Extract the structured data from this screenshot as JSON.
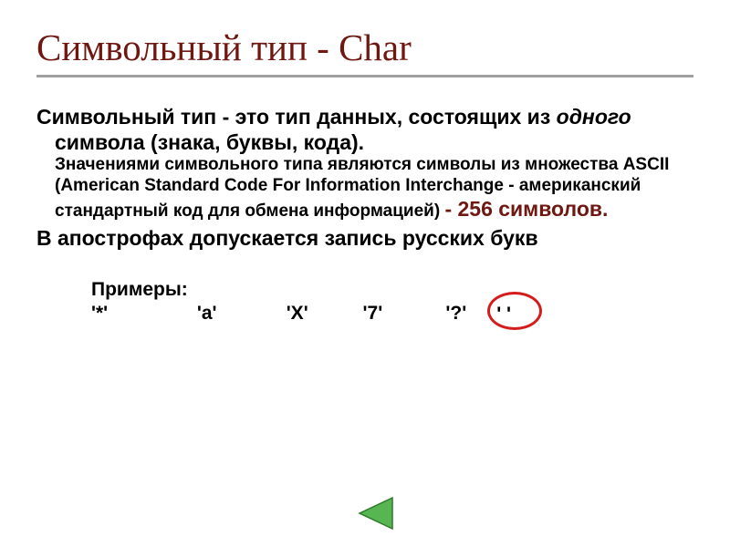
{
  "title": "Символьный тип - Char",
  "para1_lead": "Символьный тип - это тип данных, состоящих из ",
  "para1_italic": "одного",
  "para1_tail": " символа (знака, буквы, кода).",
  "sub_text": "Значениями символьного типа являются символы из множества  ASCII (American Standard Code For Information Interchange - американский стандартный код для обмена информацией) ",
  "sub_red": "- 256 символов.",
  "para2": "В апострофах допускается запись русских букв",
  "examples_label": "Примеры:",
  "ex1": "'*'",
  "ex2": "'a'",
  "ex3": "'X'",
  "ex4": "'7'",
  "ex5": "'?'",
  "ex6": "'   '"
}
